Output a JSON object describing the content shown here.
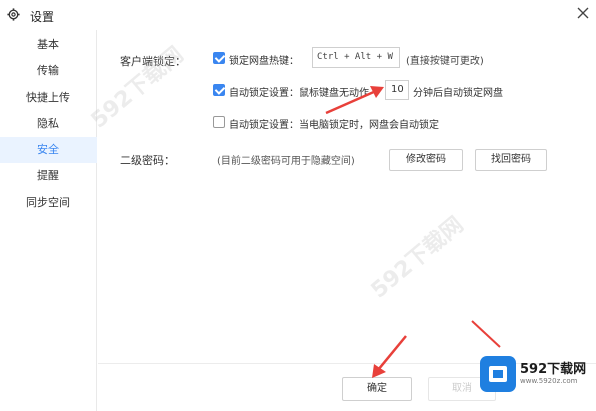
{
  "window": {
    "title": "设置",
    "close_label": "✕"
  },
  "sidebar": {
    "items": [
      {
        "label": "基本",
        "active": false
      },
      {
        "label": "传输",
        "active": false
      },
      {
        "label": "快捷上传",
        "active": false
      },
      {
        "label": "隐私",
        "active": false
      },
      {
        "label": "安全",
        "active": true
      },
      {
        "label": "提醒",
        "active": false
      },
      {
        "label": "同步空间",
        "active": false
      }
    ]
  },
  "client_lock": {
    "section_label": "客户端锁定：",
    "hotkey_option": {
      "checked": true,
      "label": "锁定网盘热键：",
      "hotkey": "Ctrl + Alt + W",
      "hint": "(直接按键可更改)"
    },
    "idle_option": {
      "checked": true,
      "label": "自动锁定设置：鼠标键盘无动作",
      "minutes": "10",
      "suffix": "分钟后自动锁定网盘"
    },
    "pc_lock_option": {
      "checked": false,
      "label": "自动锁定设置：当电脑锁定时，网盘会自动锁定"
    }
  },
  "second_password": {
    "section_label": "二级密码：",
    "hint": "(目前二级密码可用于隐藏空间)",
    "change_button": "修改密码",
    "recover_button": "找回密码"
  },
  "footer": {
    "ok_button": "确定",
    "cancel_button": "取消"
  },
  "watermark": {
    "brand": "592下载网",
    "url": "www.5920z.com",
    "faint_text": "592下载网"
  },
  "colors": {
    "accent": "#3a86f0",
    "active_bg": "#eaf3ff",
    "arrow": "#e8403a"
  }
}
